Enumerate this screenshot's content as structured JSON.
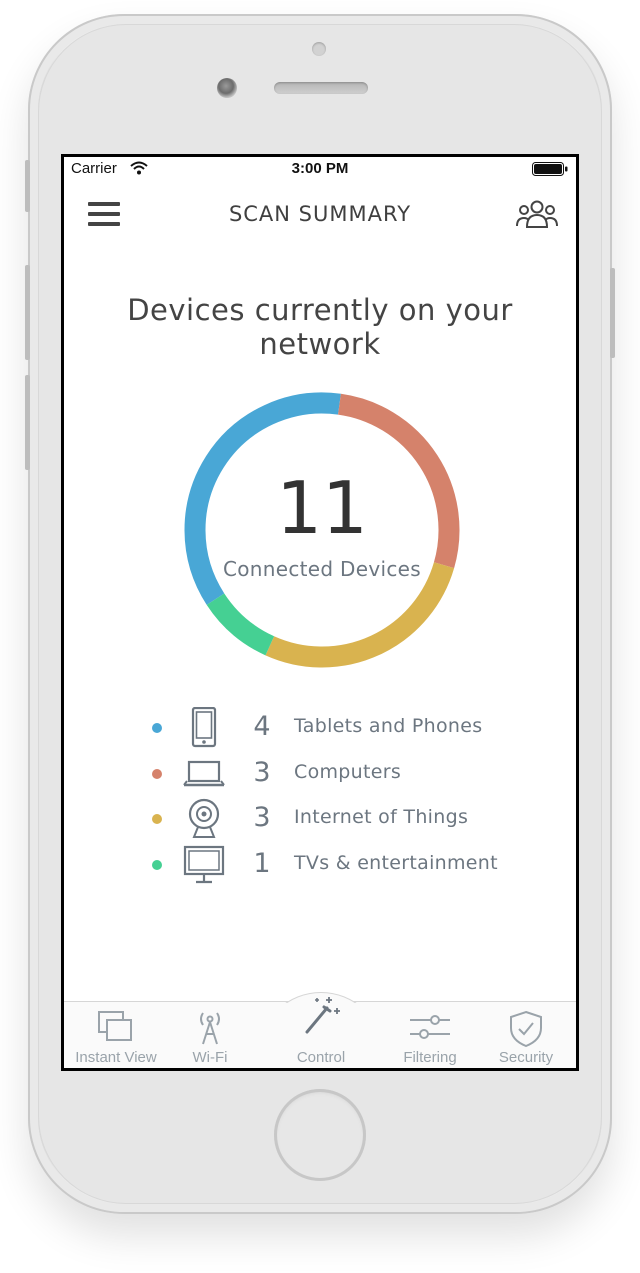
{
  "status_bar": {
    "carrier": "Carrier",
    "time": "3:00 PM"
  },
  "header": {
    "title": "SCAN SUMMARY",
    "menu_icon": "hamburger-menu-icon",
    "profile_icon": "users-group-icon"
  },
  "main": {
    "heading": "Devices currently on your network",
    "total_count": "11",
    "total_label": "Connected Devices"
  },
  "chart_data": {
    "type": "pie",
    "categories": [
      "Tablets and Phones",
      "Computers",
      "Internet of Things",
      "TVs & entertainment"
    ],
    "values": [
      4,
      3,
      3,
      1
    ],
    "colors": [
      "#49a7d6",
      "#d5826b",
      "#d9b34f",
      "#45d093"
    ]
  },
  "legend": [
    {
      "count": "4",
      "label": "Tablets and Phones",
      "color": "#49a7d6",
      "icon": "tablet-icon"
    },
    {
      "count": "3",
      "label": "Computers",
      "color": "#d5826b",
      "icon": "laptop-icon"
    },
    {
      "count": "3",
      "label": "Internet of Things",
      "color": "#d9b34f",
      "icon": "webcam-icon"
    },
    {
      "count": "1",
      "label": "TVs & entertainment",
      "color": "#45d093",
      "icon": "tv-icon"
    }
  ],
  "tabs": [
    {
      "label": "Instant View",
      "icon": "windows-icon"
    },
    {
      "label": "Wi-Fi",
      "icon": "antenna-icon"
    },
    {
      "label": "Control",
      "icon": "magic-wand-icon"
    },
    {
      "label": "Filtering",
      "icon": "sliders-icon"
    },
    {
      "label": "Security",
      "icon": "shield-check-icon"
    }
  ]
}
